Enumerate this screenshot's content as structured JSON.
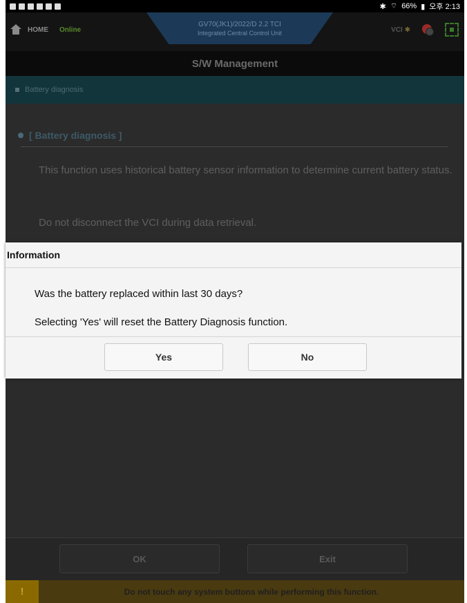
{
  "statusbar": {
    "right_text": "66%",
    "time": "오후 2:13"
  },
  "header": {
    "home_label": "HOME",
    "online_label": "Online",
    "vehicle": "GV70(JK1)/2022/D 2.2 TCI",
    "ecu": "Integrated Central Control Unit",
    "vci_label": "VCI"
  },
  "title": "S/W Management",
  "section": {
    "label": "Battery diagnosis"
  },
  "content": {
    "heading": "[ Battery diagnosis ]",
    "paragraph1": "This function uses historical battery sensor information to determine current battery status.",
    "paragraph2": "Do not disconnect the VCI during data retrieval."
  },
  "dialog": {
    "title": "Information",
    "message1": "Was the battery replaced within last 30 days?",
    "message2": "Selecting 'Yes' will reset the Battery Diagnosis function.",
    "yes": "Yes",
    "no": "No"
  },
  "footer": {
    "ok": "OK",
    "exit": "Exit",
    "warning": "Do not touch any system buttons while performing this function.",
    "warning_icon": "!"
  }
}
